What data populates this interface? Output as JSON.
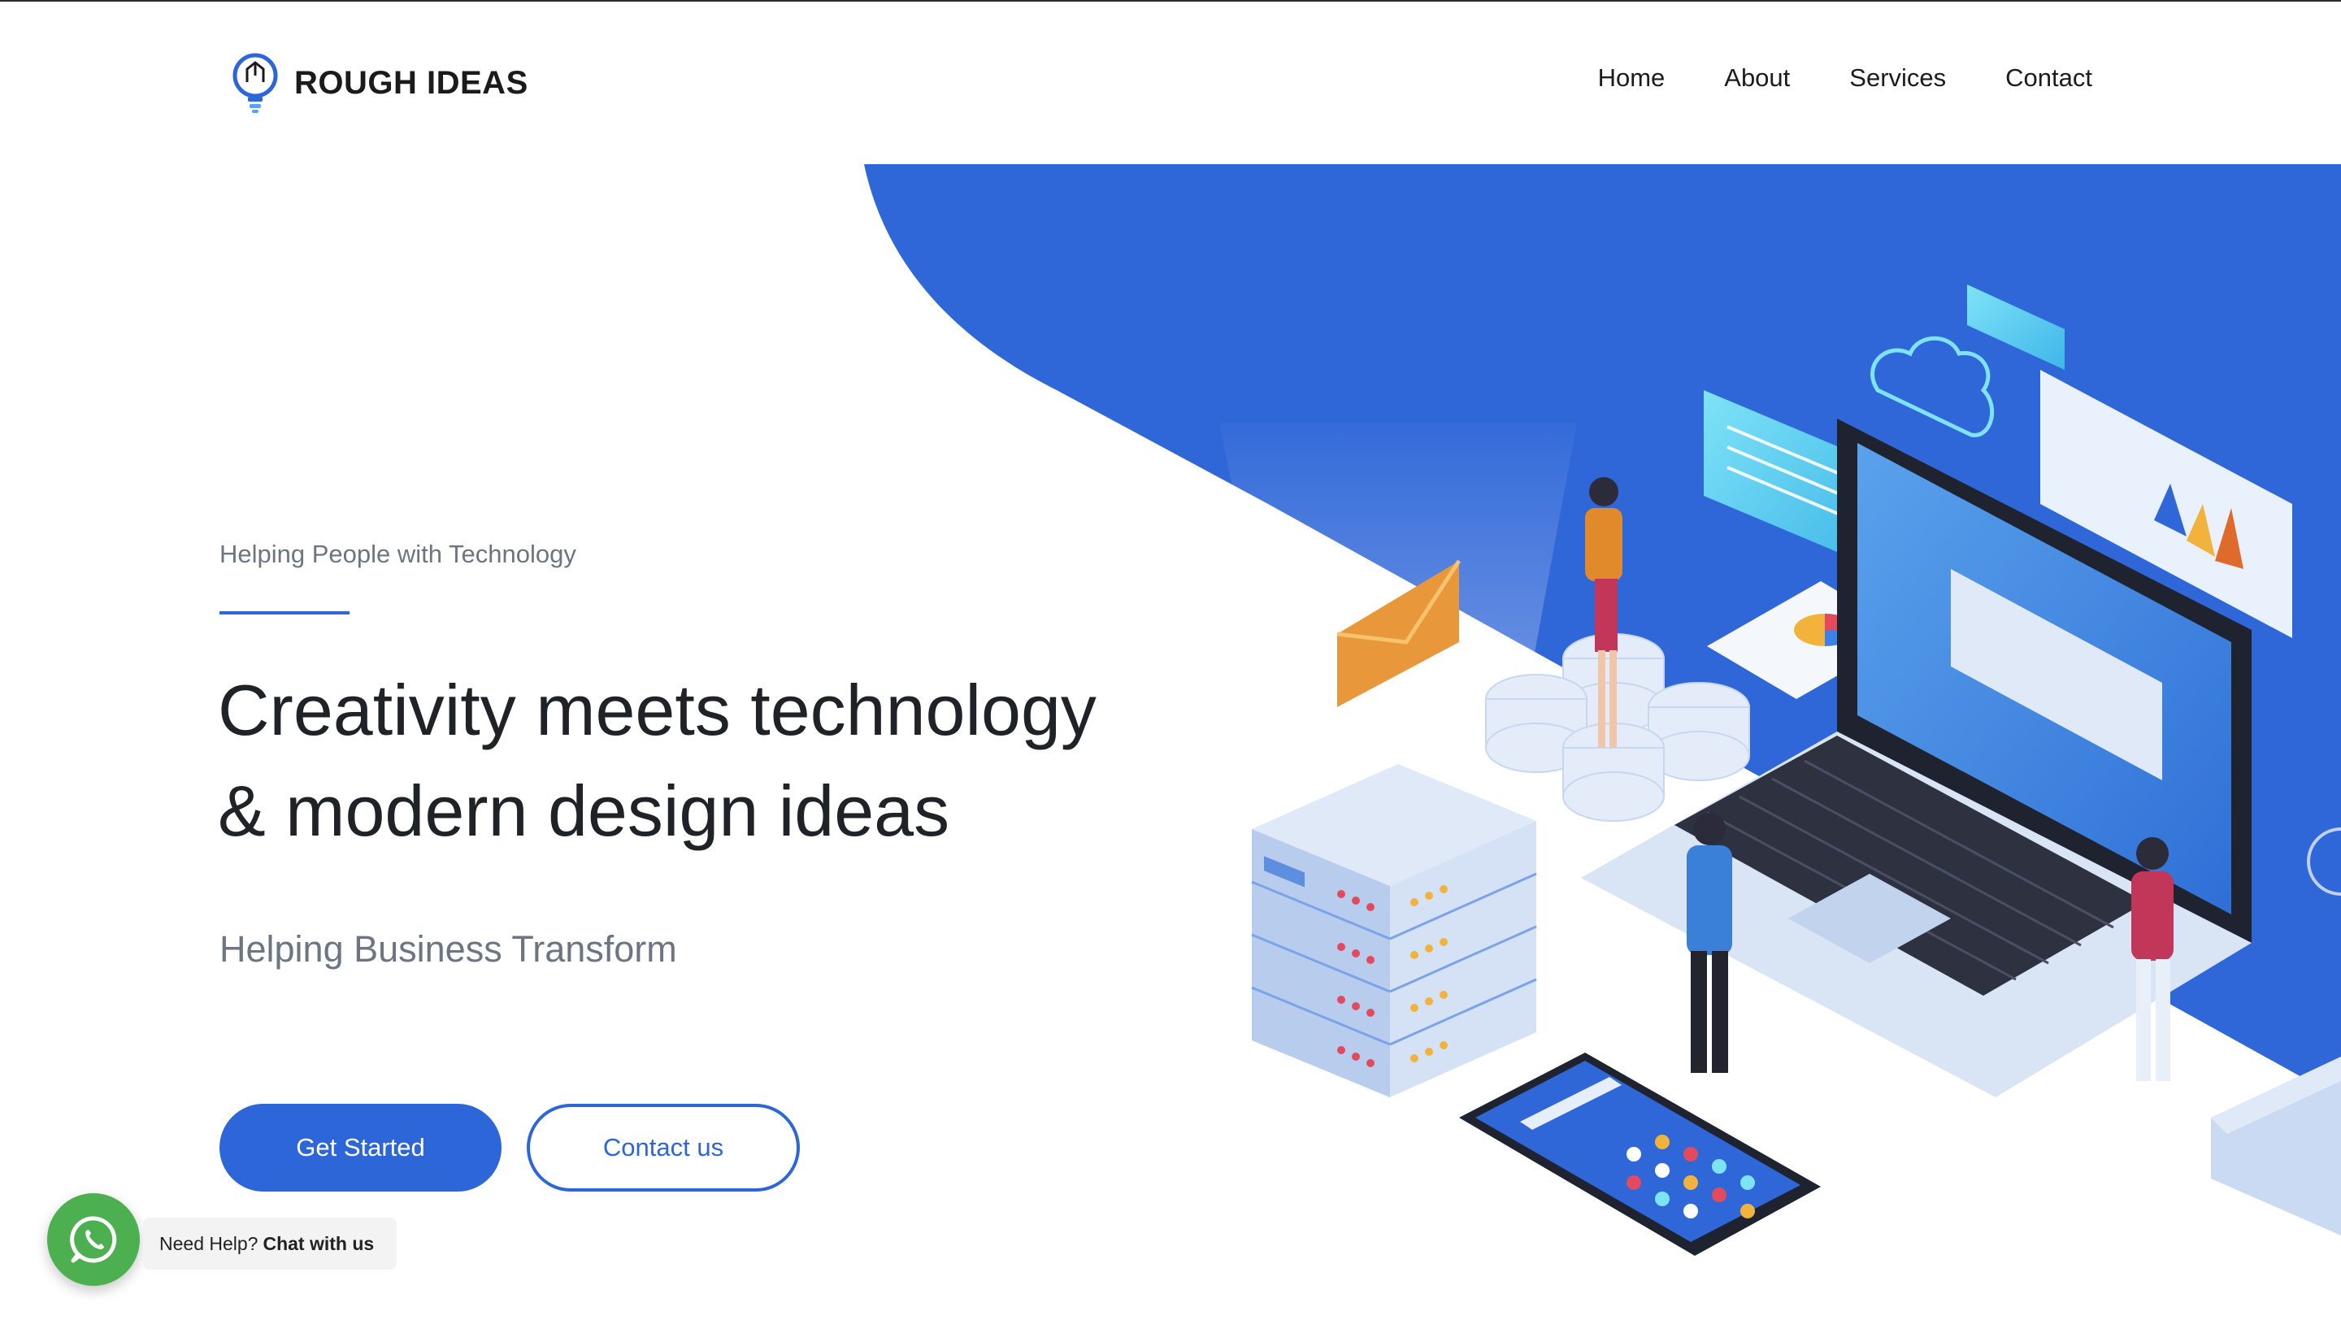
{
  "brand": {
    "name": "ROUGH IDEAS",
    "logo_icon": "lightbulb-pen-icon"
  },
  "nav": {
    "items": [
      {
        "label": "Home"
      },
      {
        "label": "About"
      },
      {
        "label": "Services"
      },
      {
        "label": "Contact"
      }
    ]
  },
  "hero": {
    "eyebrow": "Helping People with Technology",
    "headline_line1": "Creativity meets technology",
    "headline_line2": "& modern design ideas",
    "subheadline": "Helping Business Transform",
    "primary_button": "Get Started",
    "secondary_button": "Contact us",
    "illustration": "isometric-tech-illustration"
  },
  "chat_widget": {
    "icon": "whatsapp-icon",
    "prefix": "Need Help?",
    "action": "Chat with us"
  },
  "colors": {
    "accent": "#2d66d8",
    "hero_blue": "#2f67d8",
    "whatsapp_green": "#4caf50",
    "text_dark": "#1f2227",
    "text_muted": "#6c7682"
  }
}
